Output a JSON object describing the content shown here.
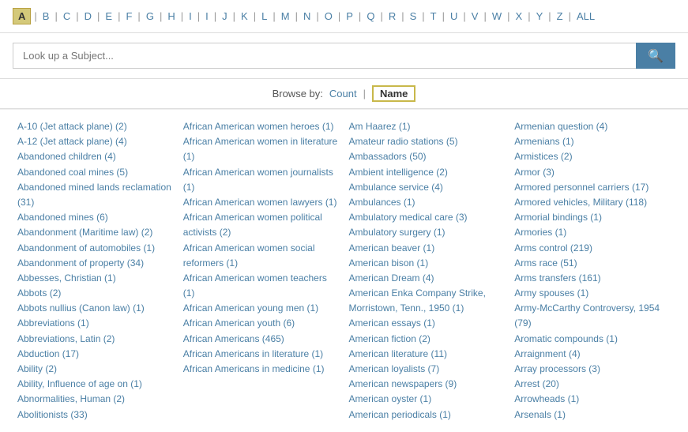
{
  "alpha": {
    "active": "A",
    "letters": [
      "A",
      "B",
      "C",
      "D",
      "E",
      "F",
      "G",
      "H",
      "I",
      "I",
      "J",
      "K",
      "L",
      "M",
      "N",
      "O",
      "P",
      "Q",
      "R",
      "S",
      "T",
      "U",
      "V",
      "W",
      "X",
      "Y",
      "Z"
    ],
    "all_label": "ALL"
  },
  "search": {
    "placeholder": "Look up a Subject..."
  },
  "browse": {
    "label": "Browse by:",
    "count_label": "Count",
    "name_label": "Name",
    "separator": "|"
  },
  "columns": [
    {
      "items": [
        "A-10 (Jet attack plane) (2)",
        "A-12 (Jet attack plane) (4)",
        "Abandoned children (4)",
        "Abandoned coal mines (5)",
        "Abandoned mined lands reclamation (31)",
        "Abandoned mines (6)",
        "Abandonment (Maritime law) (2)",
        "Abandonment of automobiles (1)",
        "Abandonment of property (34)",
        "Abbesses, Christian (1)",
        "Abbots (2)",
        "Abbots nullius (Canon law) (1)",
        "Abbreviations (1)",
        "Abbreviations, Latin (2)",
        "Abduction (17)",
        "Ability (2)",
        "Ability, Influence of age on (1)",
        "Abnormalities, Human (2)",
        "Abolitionists (33)"
      ]
    },
    {
      "items": [
        "African American women heroes (1)",
        "African American women in literature (1)",
        "African American women journalists (1)",
        "African American women lawyers (1)",
        "African American women political activists (2)",
        "African American women social reformers (1)",
        "African American women teachers (1)",
        "African American young men (1)",
        "African American youth (6)",
        "African Americans (465)",
        "African Americans in literature (1)",
        "African Americans in medicine (1)"
      ]
    },
    {
      "items": [
        "Am Haarez (1)",
        "Amateur radio stations (5)",
        "Ambassadors (50)",
        "Ambient intelligence (2)",
        "Ambulance service (4)",
        "Ambulances (1)",
        "Ambulatory medical care (3)",
        "Ambulatory surgery (1)",
        "American beaver (1)",
        "American bison (1)",
        "American Dream (4)",
        "American Enka Company Strike, Morristown, Tenn., 1950 (1)",
        "American essays (1)",
        "American fiction (2)",
        "American literature (11)",
        "American loyalists (7)",
        "American newspapers (9)",
        "American oyster (1)",
        "American periodicals (1)"
      ]
    },
    {
      "items": [
        "Armenian question (4)",
        "Armenians (1)",
        "Armistices (2)",
        "Armor (3)",
        "Armored personnel carriers (17)",
        "Armored vehicles, Military (118)",
        "Armorial bindings (1)",
        "Armories (1)",
        "Arms control (219)",
        "Arms race (51)",
        "Arms transfers (161)",
        "Army spouses (1)",
        "Army-McCarthy Controversy, 1954 (79)",
        "Aromatic compounds (1)",
        "Arraignment (4)",
        "Array processors (3)",
        "Arrest (20)",
        "Arrowheads (1)",
        "Arsenals (1)"
      ]
    }
  ]
}
